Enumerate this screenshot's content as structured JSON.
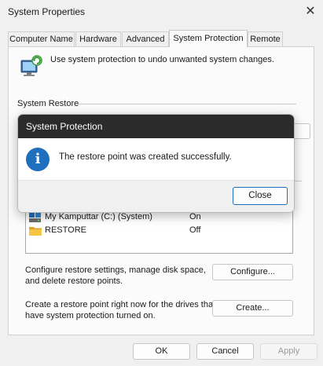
{
  "window": {
    "title": "System Properties",
    "close_glyph": "✕"
  },
  "tabs": [
    {
      "label": "Computer Name",
      "active": false
    },
    {
      "label": "Hardware",
      "active": false
    },
    {
      "label": "Advanced",
      "active": false
    },
    {
      "label": "System Protection",
      "active": true
    },
    {
      "label": "Remote",
      "active": false
    }
  ],
  "intro": {
    "text": "Use system protection to undo unwanted system changes.",
    "icon": "system-protection-icon"
  },
  "system_restore": {
    "label": "System Restore"
  },
  "drives": [
    {
      "name": "My Kamputtar (C:) (System)",
      "status": "On",
      "icon": "drive-icon"
    },
    {
      "name": "RESTORE",
      "status": "Off",
      "icon": "folder-icon"
    }
  ],
  "configure": {
    "description_line1": "Configure restore settings, manage disk space,",
    "description_line2": "and delete restore points.",
    "button": "Configure..."
  },
  "create": {
    "description_line1": "Create a restore point right now for the drives that",
    "description_line2": "have system protection turned on.",
    "button": "Create..."
  },
  "footer": {
    "ok": "OK",
    "cancel": "Cancel",
    "apply": "Apply"
  },
  "dialog": {
    "title": "System Protection",
    "message": "The restore point was created successfully.",
    "close": "Close",
    "icon": "info-icon",
    "icon_glyph": "i"
  },
  "colors": {
    "accent": "#1f6fbf",
    "dialog_title_bg": "#2b2b2b"
  }
}
